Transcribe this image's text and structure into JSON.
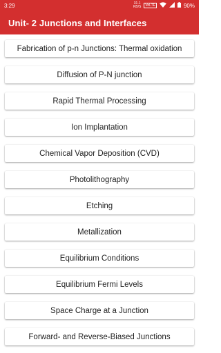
{
  "status_bar": {
    "time": "3:29",
    "speed_value": "31.1",
    "speed_unit": "KB/S",
    "volte": "VoLTE",
    "battery": "90%"
  },
  "app_bar": {
    "title": "Unit- 2 Junctions and Interfaces"
  },
  "topics": [
    {
      "label": "Fabrication of p-n Junctions: Thermal oxidation"
    },
    {
      "label": "Diffusion of P-N junction"
    },
    {
      "label": "Rapid Thermal Processing"
    },
    {
      "label": "Ion Implantation"
    },
    {
      "label": "Chemical Vapor Deposition (CVD)"
    },
    {
      "label": "Photolithography"
    },
    {
      "label": "Etching"
    },
    {
      "label": "Metallization"
    },
    {
      "label": "Equilibrium Conditions"
    },
    {
      "label": "Equilibrium Fermi Levels"
    },
    {
      "label": "Space Charge at a Junction"
    },
    {
      "label": "Forward- and Reverse-Biased Junctions"
    }
  ],
  "colors": {
    "primary": "#d32f2f"
  }
}
